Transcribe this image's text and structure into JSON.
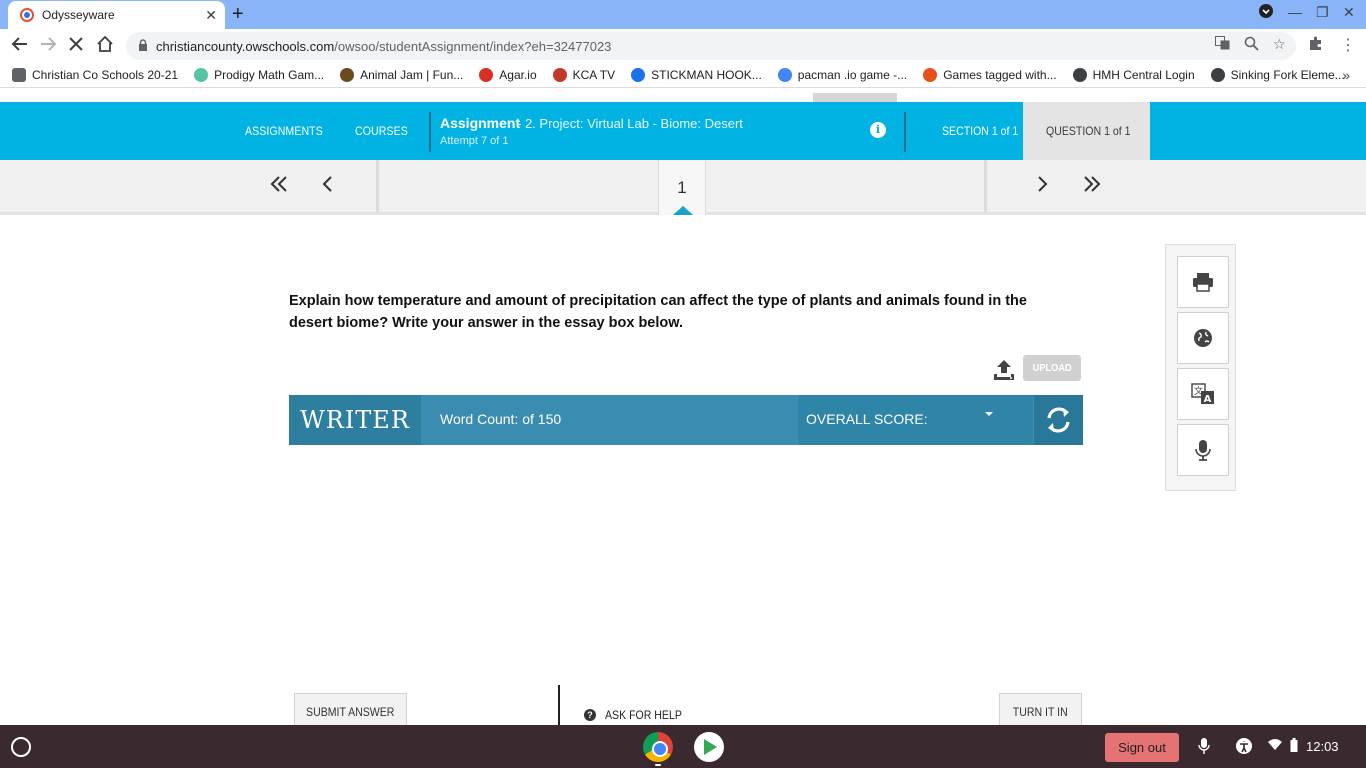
{
  "browser": {
    "tab_title": "Odysseyware",
    "url_host": "christiancounty.owschools.com",
    "url_path": "/owsoo/studentAssignment/index?eh=32477023",
    "bookmarks": [
      {
        "label": "Christian Co Schools 20-21",
        "color": "#5f6368"
      },
      {
        "label": "Prodigy Math Gam...",
        "color": "#58c4a6"
      },
      {
        "label": "Animal Jam | Fun...",
        "color": "#6b4a1e"
      },
      {
        "label": "Agar.io",
        "color": "#d93025"
      },
      {
        "label": "KCA TV",
        "color": "#c0392b"
      },
      {
        "label": "STICKMAN HOOK...",
        "color": "#1a73e8"
      },
      {
        "label": "pacman .io game -...",
        "color": "#4285f4"
      },
      {
        "label": "Games tagged with...",
        "color": "#e8501a"
      },
      {
        "label": "HMH Central Login",
        "color": "#3c4043"
      },
      {
        "label": "Sinking Fork Eleme...",
        "color": "#3c4043"
      }
    ]
  },
  "nav": {
    "assignments": "ASSIGNMENTS",
    "courses": "COURSES",
    "assignment_label": "Assignment",
    "assignment_name": "- 2. Project: Virtual Lab - Biome: Desert",
    "attempt": "Attempt 7 of 1",
    "section": "SECTION 1 of 1",
    "question": "QUESTION 1 of 1",
    "accent_color": "#00b3e3"
  },
  "pager": {
    "current_page": "1",
    "first_icon": "double-chevron-left-icon",
    "prev_icon": "chevron-left-icon",
    "next_icon": "chevron-right-icon",
    "last_icon": "double-chevron-right-icon"
  },
  "question": {
    "text": "Explain how temperature and amount of precipitation can affect the type of plants and animals found in the desert biome? Write your answer in the essay box below."
  },
  "upload": {
    "label": "UPLOAD"
  },
  "writer": {
    "logo": "WRITER",
    "word_count": "Word Count: of 150",
    "overall_score": "OVERALL SCORE:"
  },
  "tools": [
    "printer-icon",
    "globe-icon",
    "translate-icon",
    "microphone-icon"
  ],
  "footer": {
    "submit": "SUBMIT ANSWER",
    "help": "ASK FOR HELP",
    "turn_in": "TURN IT IN"
  },
  "shelf": {
    "sign_out": "Sign out",
    "time": "12:03"
  }
}
